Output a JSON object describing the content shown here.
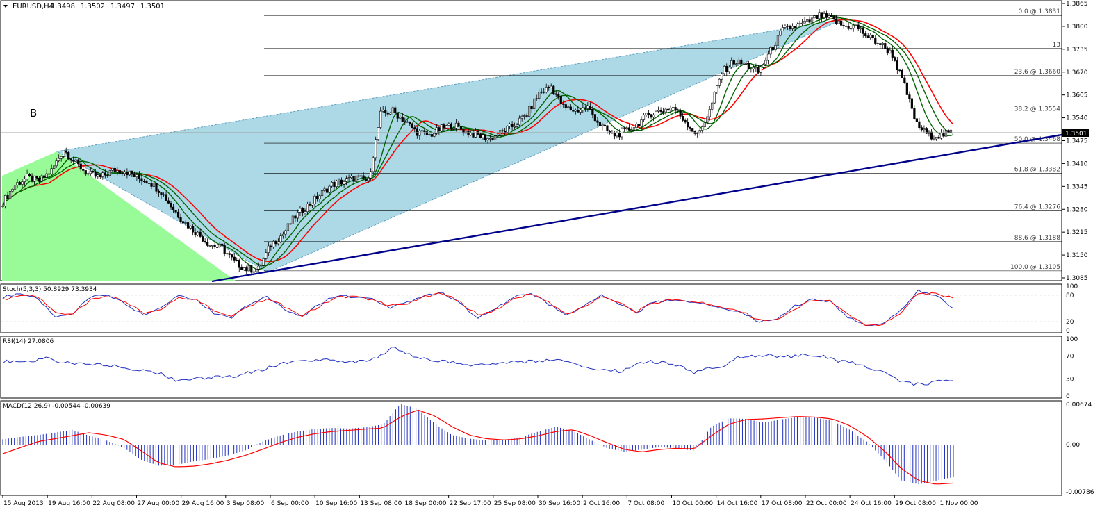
{
  "chart_data": [
    {
      "type": "candlestick",
      "title": "EURUSD,H4",
      "ohlc": {
        "open": "1.3498",
        "high": "1.3502",
        "low": "1.3497",
        "close": "1.3501"
      },
      "annotation": "B",
      "current_price": "1.3501",
      "ylim": [
        1.3085,
        1.3865
      ],
      "y_ticks": [
        "1.3865",
        "1.3800",
        "1.3735",
        "1.3670",
        "1.3605",
        "1.3540",
        "1.3475",
        "1.3410",
        "1.3345",
        "1.3280",
        "1.3215",
        "1.3150",
        "1.3085"
      ],
      "y_tick_values": [
        1.3865,
        1.38,
        1.3735,
        1.367,
        1.3605,
        1.354,
        1.3475,
        1.341,
        1.3345,
        1.328,
        1.3215,
        1.315,
        1.3085
      ],
      "fibonacci_levels": [
        {
          "label": "0.0 @ 1.3831",
          "price": 1.3831
        },
        {
          "label": "13",
          "price": 1.3737
        },
        {
          "label": "23.6 @ 1.3660",
          "price": 1.366
        },
        {
          "label": "38.2 @ 1.3554",
          "price": 1.3554
        },
        {
          "label": "50.0 @ 1.3468",
          "price": 1.3468
        },
        {
          "label": "61.8 @ 1.3382",
          "price": 1.3382
        },
        {
          "label": "76.4 @ 1.3276",
          "price": 1.3276
        },
        {
          "label": "88.6 @ 1.3188",
          "price": 1.3188
        },
        {
          "label": "100.0 @ 1.3105",
          "price": 1.3105
        }
      ],
      "price_path": [
        1.33,
        1.335,
        1.337,
        1.336,
        1.339,
        1.345,
        1.341,
        1.338,
        1.337,
        1.339,
        1.339,
        1.337,
        1.336,
        1.333,
        1.328,
        1.324,
        1.321,
        1.318,
        1.317,
        1.313,
        1.311,
        1.311,
        1.318,
        1.321,
        1.326,
        1.329,
        1.332,
        1.335,
        1.336,
        1.337,
        1.336,
        1.355,
        1.356,
        1.353,
        1.35,
        1.349,
        1.351,
        1.352,
        1.35,
        1.349,
        1.348,
        1.35,
        1.352,
        1.355,
        1.361,
        1.363,
        1.357,
        1.356,
        1.357,
        1.352,
        1.349,
        1.35,
        1.352,
        1.355,
        1.356,
        1.357,
        1.353,
        1.349,
        1.356,
        1.367,
        1.37,
        1.369,
        1.367,
        1.373,
        1.379,
        1.38,
        1.381,
        1.383,
        1.382,
        1.38,
        1.38,
        1.377,
        1.375,
        1.372,
        1.363,
        1.352,
        1.349,
        1.349,
        1.35
      ]
    },
    {
      "type": "line",
      "title": "Stoch(5,3,3) 50.8929 73.3934",
      "ylim": [
        0,
        100
      ],
      "y_ticks": [
        "100",
        "80",
        "20",
        "0"
      ],
      "series": [
        {
          "color": "#1f2fbf",
          "values": [
            75,
            85,
            70,
            30,
            40,
            75,
            80,
            60,
            35,
            55,
            80,
            70,
            40,
            30,
            60,
            75,
            50,
            30,
            60,
            80,
            75,
            70,
            50,
            65,
            80,
            85,
            60,
            30,
            50,
            75,
            85,
            60,
            35,
            55,
            80,
            60,
            40,
            65,
            70,
            65,
            60,
            50,
            40,
            20,
            25,
            55,
            70,
            65,
            30,
            10,
            15,
            45,
            90,
            80,
            50
          ]
        },
        {
          "color": "#ff0000",
          "values": [
            70,
            80,
            75,
            40,
            38,
            68,
            78,
            65,
            40,
            50,
            75,
            72,
            45,
            32,
            55,
            72,
            55,
            33,
            55,
            76,
            76,
            70,
            55,
            62,
            78,
            84,
            64,
            35,
            47,
            70,
            83,
            63,
            38,
            52,
            77,
            62,
            42,
            62,
            70,
            66,
            61,
            52,
            42,
            23,
            23,
            50,
            68,
            66,
            35,
            12,
            14,
            40,
            85,
            82,
            73
          ]
        }
      ]
    },
    {
      "type": "line",
      "title": "RSI(14) 27.0806",
      "ylim": [
        0,
        100
      ],
      "y_ticks": [
        "100",
        "70",
        "30",
        "0"
      ],
      "series": [
        {
          "color": "#1f2fbf",
          "values": [
            60,
            62,
            58,
            68,
            60,
            55,
            56,
            55,
            52,
            48,
            45,
            40,
            28,
            30,
            32,
            33,
            35,
            40,
            45,
            55,
            60,
            60,
            62,
            63,
            60,
            62,
            65,
            88,
            75,
            66,
            62,
            60,
            55,
            55,
            56,
            58,
            60,
            60,
            65,
            62,
            55,
            48,
            45,
            43,
            55,
            60,
            58,
            52,
            40,
            48,
            50,
            68,
            70,
            72,
            68,
            70,
            72,
            70,
            62,
            58,
            50,
            42,
            30,
            22,
            20,
            28,
            27
          ]
        }
      ]
    },
    {
      "type": "bar",
      "title": "MACD(12,26,9) -0.00544 -0.00639",
      "ylim": [
        -0.00786,
        0.00674
      ],
      "y_ticks": [
        "0.00674",
        "0.00",
        "-0.00786"
      ],
      "series": [
        {
          "color": "#1f2fbf",
          "values": [
            0.0009,
            0.0013,
            0.0016,
            0.002,
            0.0025,
            0.0015,
            0.0007,
            -0.0005,
            -0.0025,
            -0.0035,
            -0.0034,
            -0.0028,
            -0.0024,
            -0.0018,
            -0.001,
            0.0005,
            0.0015,
            0.0022,
            0.0026,
            0.0028,
            0.0027,
            0.0029,
            0.0034,
            0.0068,
            0.006,
            0.0035,
            0.0016,
            0.001,
            0.0007,
            0.0008,
            0.0013,
            0.0022,
            0.003,
            0.0023,
            0.0008,
            -0.0006,
            -0.0012,
            -0.0008,
            -0.0004,
            -0.0006,
            -0.001,
            0.003,
            0.0044,
            0.0043,
            0.0037,
            0.0042,
            0.0046,
            0.0045,
            0.004,
            0.0025,
            0.0005,
            -0.0025,
            -0.006,
            -0.0066,
            -0.006,
            -0.0054
          ]
        },
        {
          "color": "#ff0000",
          "values": [
            -0.0015,
            -0.0005,
            0.0005,
            0.001,
            0.0015,
            0.002,
            0.0016,
            0.0009,
            -0.001,
            -0.003,
            -0.0037,
            -0.0036,
            -0.0032,
            -0.0026,
            -0.0018,
            -0.0008,
            0.0003,
            0.0012,
            0.0018,
            0.0022,
            0.0024,
            0.0026,
            0.0028,
            0.0046,
            0.0058,
            0.0048,
            0.003,
            0.0016,
            0.001,
            0.0008,
            0.001,
            0.0015,
            0.0022,
            0.0025,
            0.0015,
            0.0003,
            -0.0008,
            -0.0012,
            -0.0008,
            -0.0006,
            -0.0007,
            0.0015,
            0.0034,
            0.0042,
            0.0043,
            0.0045,
            0.0047,
            0.0046,
            0.0043,
            0.0032,
            0.0014,
            -0.001,
            -0.004,
            -0.006,
            -0.0066,
            -0.0064
          ]
        }
      ]
    }
  ],
  "x_ticks": [
    "15 Aug 2013",
    "19 Aug 16:00",
    "22 Aug 08:00",
    "27 Aug 00:00",
    "29 Aug 16:00",
    "3 Sep 08:00",
    "6 Sep 00:00",
    "10 Sep 16:00",
    "13 Sep 08:00",
    "18 Sep 00:00",
    "22 Sep 17:00",
    "25 Sep 08:00",
    "30 Sep 16:00",
    "2 Oct 16:00",
    "7 Oct 08:00",
    "10 Oct 00:00",
    "14 Oct 16:00",
    "17 Oct 08:00",
    "22 Oct 00:00",
    "24 Oct 16:00",
    "29 Oct 08:00",
    "1 Nov 00:00"
  ],
  "colors": {
    "background": "#ffffff",
    "grid": "#000000",
    "wedge": "#add8e6",
    "triangle": "#98fb98",
    "trendline": "#00008b",
    "ma_red": "#ff0000",
    "ma_green": "#006400",
    "indicator_blue": "#1f2fbf"
  }
}
